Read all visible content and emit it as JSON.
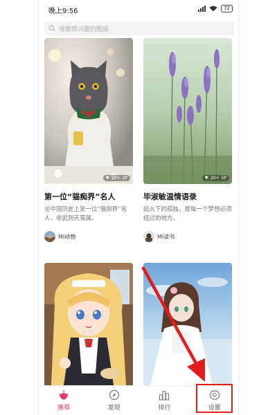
{
  "status_bar": {
    "time": "晚上9:56",
    "battery": "72"
  },
  "search": {
    "placeholder": "搜索感兴趣的图报"
  },
  "cards": [
    {
      "title": "第一位“猫痴界”名人",
      "desc": "论中国历史上第一位“猫痴界”名人，非武则天莫属。",
      "author": "MI动物",
      "badge_likes": "10+",
      "badge_pages": "2P"
    },
    {
      "title": "毕淑敏温情语录",
      "desc": "焰火下的孤独，是每一个梦想必须经过的地方。",
      "author": "MI读书",
      "badge_likes": "20+",
      "badge_pages": "5P"
    }
  ],
  "tabs": [
    {
      "label": "推荐",
      "icon": "flower-icon",
      "active": true
    },
    {
      "label": "发现",
      "icon": "compass-icon",
      "active": false
    },
    {
      "label": "排行",
      "icon": "bar-chart-icon",
      "active": false
    },
    {
      "label": "设置",
      "icon": "gear-icon",
      "active": false
    }
  ],
  "colors": {
    "accent": "#e8386a",
    "highlight": "#e51c1c"
  }
}
